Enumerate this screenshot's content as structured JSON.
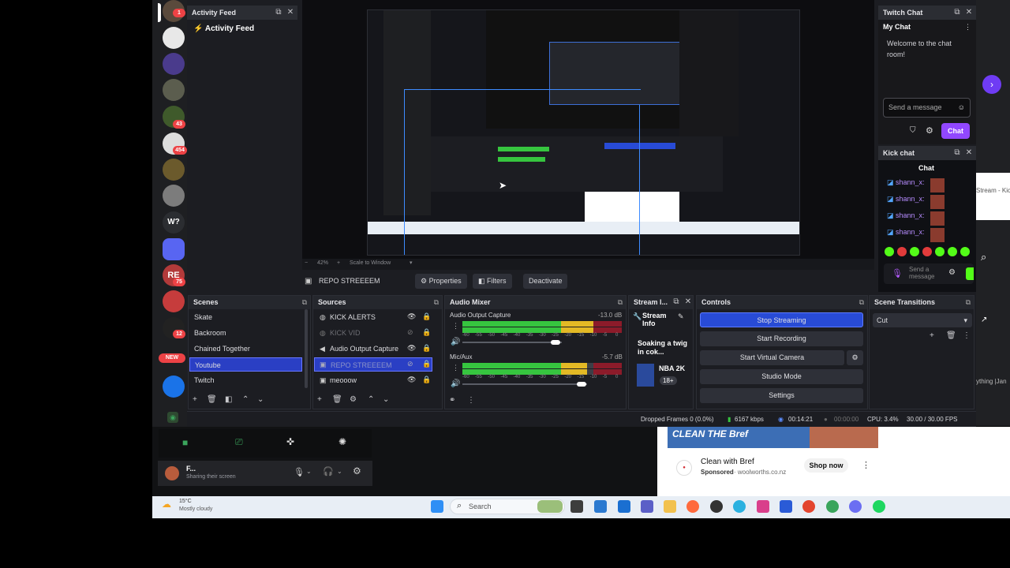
{
  "discord": {
    "rail_badges": [
      "1",
      "43",
      "454",
      "12",
      "75",
      "12"
    ],
    "rail_icons": [
      "W?",
      "RE"
    ],
    "new_label": "NEW",
    "user_name": "F...",
    "user_status": "Sharing their screen"
  },
  "obs": {
    "activity_feed": {
      "title": "Activity Feed",
      "subtitle": "Activity Feed"
    },
    "preview": {
      "zoom": "42%",
      "scale_mode": "Scale to Window"
    },
    "source_toolbar": {
      "selected_source": "REPO STREEEEM",
      "properties": "Properties",
      "filters": "Filters",
      "deactivate": "Deactivate"
    },
    "scenes": {
      "title": "Scenes",
      "items": [
        "Skate",
        "Backroom",
        "Chained Together",
        "Youtube",
        "Twitch"
      ],
      "selected_index": 3
    },
    "sources": {
      "title": "Sources",
      "items": [
        "KICK ALERTS",
        "KICK VID",
        "Audio Output Capture",
        "REPO STREEEEM",
        "meooow"
      ]
    },
    "audio_mixer": {
      "title": "Audio Mixer",
      "channels": [
        {
          "name": "Audio Output Capture",
          "db": "-13.0 dB",
          "level": 0.82,
          "volume": 0.74
        },
        {
          "name": "Mic/Aux",
          "db": "-5.7 dB",
          "level": 0.78,
          "volume": 0.78
        }
      ],
      "scale": [
        "-60",
        "-55",
        "-50",
        "-45",
        "-40",
        "-35",
        "-30",
        "-25",
        "-20",
        "-15",
        "-10",
        "-5",
        "0"
      ]
    },
    "stream_info": {
      "title": "Stream I...",
      "heading": "Stream Info",
      "stream_title": "Soaking a twig in cok...",
      "category": "NBA 2K",
      "rating": "18+"
    },
    "controls": {
      "title": "Controls",
      "stop_streaming": "Stop Streaming",
      "start_recording": "Start Recording",
      "start_virtual_camera": "Start Virtual Camera",
      "studio_mode": "Studio Mode",
      "settings": "Settings"
    },
    "scene_transitions": {
      "title": "Scene Transitions",
      "transition": "Cut"
    },
    "statusbar": {
      "dropped_frames": "Dropped Frames 0 (0.0%)",
      "bitrate": "6167 kbps",
      "stream_time": "00:14:21",
      "rec_time": "00:00:00",
      "cpu": "CPU: 3.4%",
      "fps": "30.00 / 30.00 FPS"
    },
    "twitch_chat": {
      "title": "Twitch Chat",
      "heading": "My Chat",
      "welcome": "Welcome to the chat room!",
      "placeholder": "Send a message",
      "chat_button": "Chat"
    },
    "kick_chat": {
      "title": "Kick chat",
      "heading": "Chat",
      "messages": [
        "shann_x:",
        "shann_x:",
        "shann_x:",
        "shann_x:"
      ],
      "placeholder": "Send a message"
    }
  },
  "browser": {
    "sidebar_text": [
      "Stream - Kic",
      "ything |Jan"
    ],
    "colors": {
      "accent": "#6f3cf4"
    }
  },
  "ad": {
    "banner": "CLEAN THE Bref",
    "title": "Clean with Bref",
    "sponsored": "Sponsored",
    "domain": "woolworths.co.nz",
    "cta": "Shop now"
  },
  "taskbar": {
    "weather_temp": "15°C",
    "weather_desc": "Mostly cloudy",
    "search": "Search"
  },
  "colors": {
    "obs_bg": "#1c1d22",
    "selection": "#2a3fc4",
    "twitch_purple": "#9147ff",
    "kick_green": "#53fc18",
    "meter_green": "#36c53f"
  }
}
